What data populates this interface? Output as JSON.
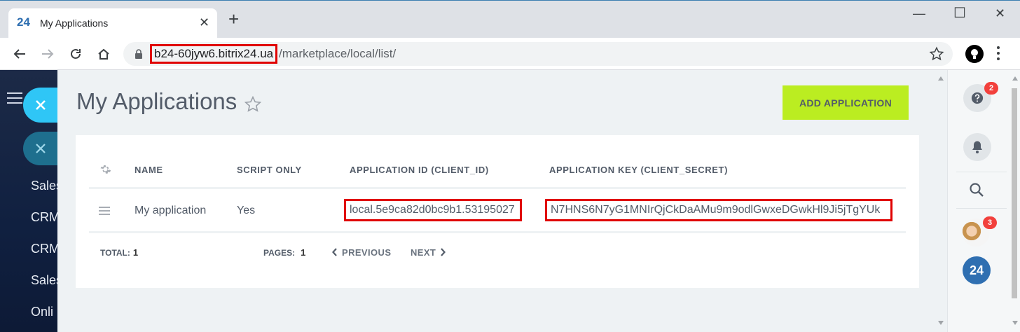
{
  "browser": {
    "tab_favicon": "24",
    "tab_title": "My Applications",
    "url_host": "b24-60jyw6.bitrix24.ua",
    "url_path": "/marketplace/local/list/"
  },
  "sidebar": {
    "items": [
      "Sales",
      "CRM",
      "CRM",
      "Sales",
      "Onli"
    ]
  },
  "page": {
    "title": "My Applications",
    "add_button": "ADD APPLICATION"
  },
  "table": {
    "columns": [
      "NAME",
      "SCRIPT ONLY",
      "APPLICATION ID (CLIENT_ID)",
      "APPLICATION KEY (CLIENT_SECRET)"
    ],
    "rows": [
      {
        "name": "My application",
        "script_only": "Yes",
        "client_id": "local.5e9ca82d0bc9b1.53195027",
        "client_secret": "N7HNS6N7yG1MNIrQjCkDaAMu9m9odlGwxeDGwkHl9Ji5jTgYUk"
      }
    ]
  },
  "footer": {
    "total_label": "TOTAL:",
    "total_value": "1",
    "pages_label": "PAGES:",
    "pages_value": "1",
    "previous": "PREVIOUS",
    "next": "NEXT"
  },
  "right_panel": {
    "help_badge": "2",
    "avatar_badge": "3",
    "logo": "24"
  },
  "colors": {
    "accent_button": "#bbed21",
    "highlight_box": "#e00000",
    "badge": "#f2403c",
    "brand_blue": "#2f6fb1"
  }
}
